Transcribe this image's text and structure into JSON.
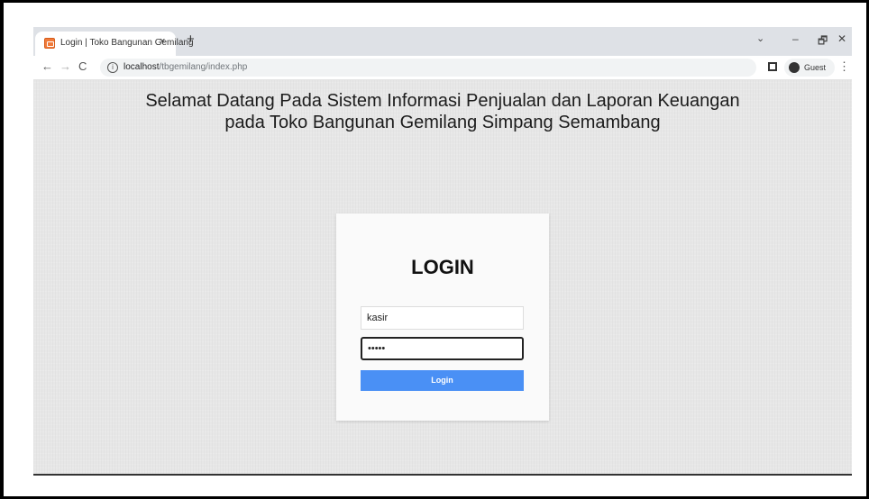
{
  "browser": {
    "tab_title": "Login | Toko Bangunan Gemilang",
    "tab_close": "×",
    "new_tab": "+",
    "window_menu": "⌄",
    "minimize": "–",
    "maximize": "🗗",
    "close": "✕",
    "url_host": "localhost",
    "url_path": "/tbgemilang/index.php",
    "profile_label": "Guest",
    "more": "⋮",
    "back": "←",
    "forward": "→",
    "reload": "C",
    "info": "i"
  },
  "page": {
    "heading_line1": "Selamat Datang Pada Sistem Informasi Penjualan dan Laporan Keuangan",
    "heading_line2": "pada Toko Bangunan Gemilang Simpang Semambang",
    "login_title": "LOGIN",
    "username_value": "kasir",
    "password_value": "•••••",
    "login_button": "Login"
  },
  "colors": {
    "accent": "#4a90f5",
    "page_bg": "#e7e7e7"
  }
}
